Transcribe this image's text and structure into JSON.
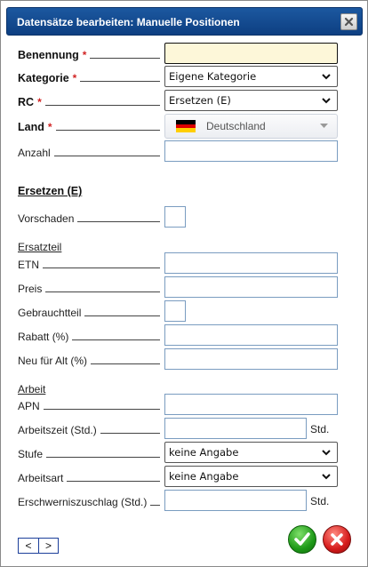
{
  "window": {
    "title": "Datensätze bearbeiten: Manuelle Positionen",
    "close_icon": "close-icon"
  },
  "header_fields": {
    "benennung": {
      "label": "Benennung",
      "value": ""
    },
    "kategorie": {
      "label": "Kategorie",
      "value": "Eigene Kategorie"
    },
    "rc": {
      "label": "RC",
      "value": "Ersetzen (E)"
    },
    "land": {
      "label": "Land",
      "value": "Deutschland"
    },
    "anzahl": {
      "label": "Anzahl",
      "value": ""
    }
  },
  "section": {
    "title": "Ersetzen (E)",
    "vorschaden_label": "Vorschaden"
  },
  "ersatzteil": {
    "title": "Ersatzteil",
    "etn_label": "ETN",
    "preis_label": "Preis",
    "gebrauchtteil_label": "Gebrauchtteil",
    "rabatt_label": "Rabatt (%)",
    "neu_fuer_alt_label": "Neu für Alt (%)"
  },
  "arbeit": {
    "title": "Arbeit",
    "apn_label": "APN",
    "arbeitszeit_label": "Arbeitszeit (Std.)",
    "arbeitszeit_unit": "Std.",
    "stufe": {
      "label": "Stufe",
      "value": "keine Angabe"
    },
    "arbeitsart": {
      "label": "Arbeitsart",
      "value": "keine Angabe"
    },
    "erschwernis_label": "Erschwerniszuschlag (Std.)",
    "erschwernis_unit": "Std."
  },
  "footer": {
    "prev_label": "<",
    "next_label": ">",
    "confirm_icon": "checkmark-icon",
    "cancel_icon": "cross-icon"
  },
  "colors": {
    "title_bar": "#134a8e",
    "required_marker": "#d12424",
    "highlight_field": "#fdf7d9",
    "confirm": "#1e9a18",
    "cancel": "#d61b1b"
  },
  "required_marker": "*"
}
